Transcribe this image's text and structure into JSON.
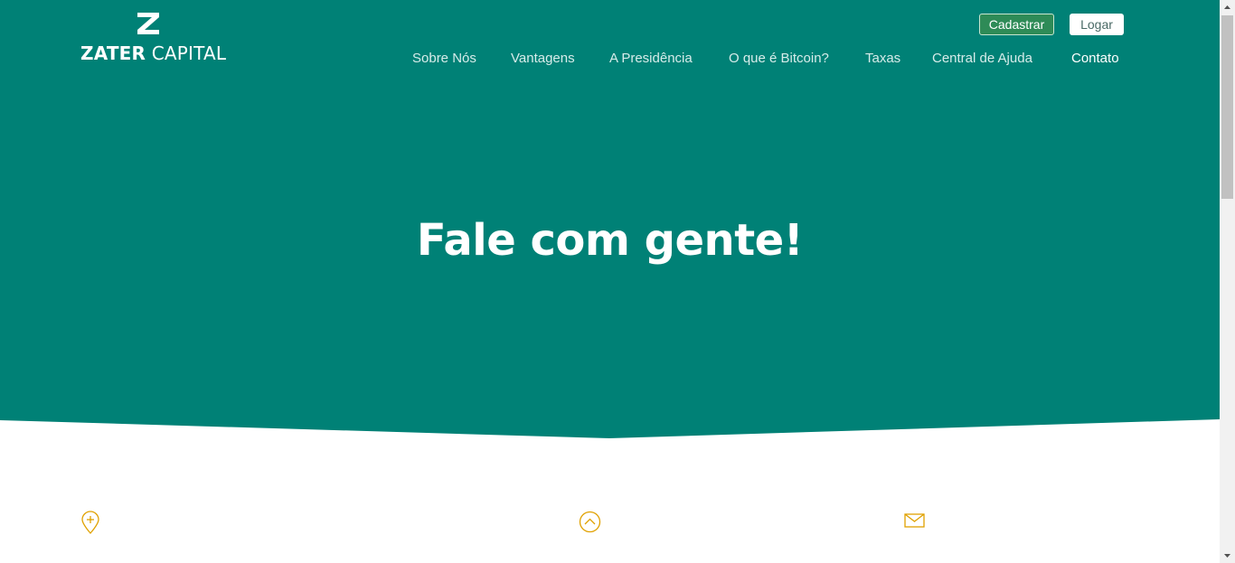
{
  "brand": {
    "name_bold": "ZATER",
    "name_light": "CAPITAL",
    "teal": "#008176",
    "accent_gold": "#e0a100"
  },
  "header": {
    "register_label": "Cadastrar",
    "login_label": "Logar",
    "nav": [
      {
        "label": "Sobre Nós"
      },
      {
        "label": "Vantagens"
      },
      {
        "label": "A Presidência"
      },
      {
        "label": "O que é Bitcoin?"
      },
      {
        "label": "Taxas"
      },
      {
        "label": "Central de Ajuda"
      },
      {
        "label": "Contato",
        "active": true
      }
    ]
  },
  "hero": {
    "title": "Fale com gente!"
  },
  "contact_icons": [
    {
      "icon": "map-pin-icon"
    },
    {
      "icon": "chevron-up-circle-icon"
    },
    {
      "icon": "envelope-icon"
    }
  ]
}
